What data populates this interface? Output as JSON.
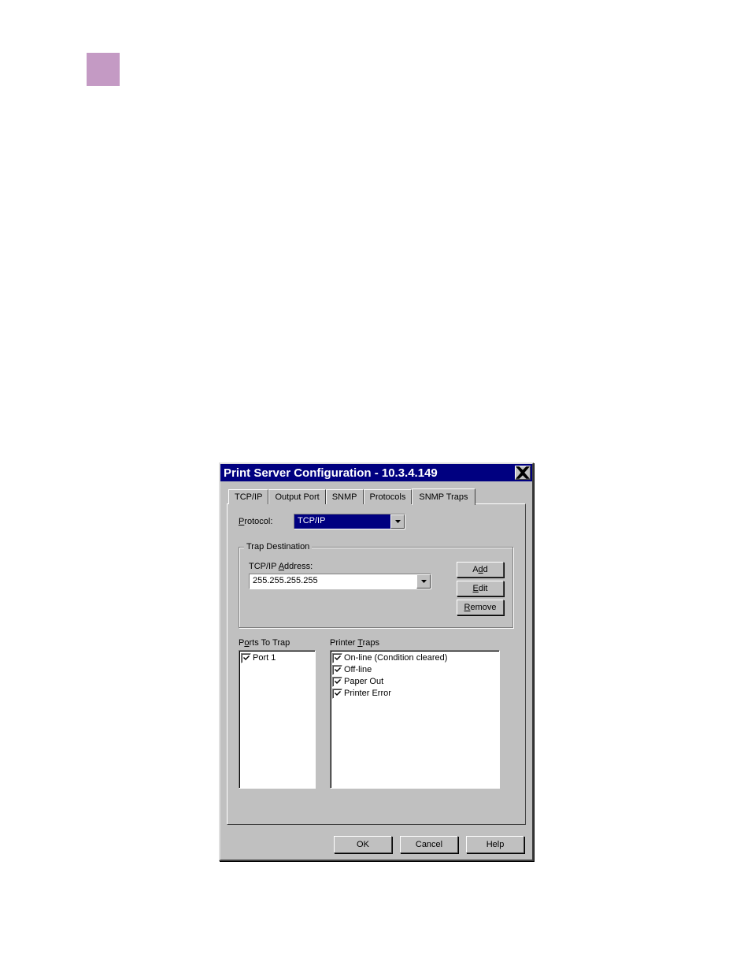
{
  "window": {
    "title": "Print Server Configuration - 10.3.4.149"
  },
  "tabs": [
    "TCP/IP",
    "Output Port",
    "SNMP",
    "Protocols",
    "SNMP Traps"
  ],
  "protocol": {
    "label": "Protocol:",
    "value": "TCP/IP"
  },
  "trapDestination": {
    "legend": "Trap Destination",
    "addressLabel": "TCP/IP Address:",
    "addressValue": "255.255.255.255",
    "buttons": {
      "add": "Add",
      "edit": "Edit",
      "remove": "Remove"
    }
  },
  "portsToTrap": {
    "label": "Ports To Trap",
    "items": [
      "Port 1"
    ]
  },
  "printerTraps": {
    "label": "Printer Traps",
    "items": [
      "On-line (Condition cleared)",
      "Off-line",
      "Paper Out",
      "Printer Error"
    ]
  },
  "dialogButtons": {
    "ok": "OK",
    "cancel": "Cancel",
    "help": "Help"
  }
}
